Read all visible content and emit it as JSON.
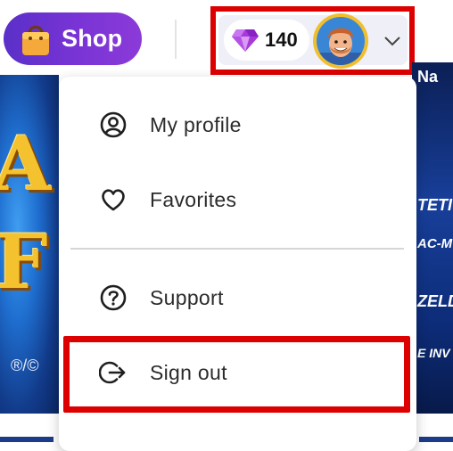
{
  "header": {
    "shop_label": "Shop",
    "gems_count": "140"
  },
  "menu": {
    "items": [
      {
        "label": "My profile",
        "icon": "user-circle-icon"
      },
      {
        "label": "Favorites",
        "icon": "heart-icon"
      },
      {
        "label": "Support",
        "icon": "question-circle-icon"
      },
      {
        "label": "Sign out",
        "icon": "sign-out-icon"
      }
    ]
  },
  "background": {
    "left_art_lines": [
      "A",
      "F"
    ],
    "left_mark": "®/©",
    "right_thumbs": [
      "Na",
      "TETI",
      "AC-M",
      "ZELD",
      "E INV"
    ]
  },
  "colors": {
    "shop_gradient_start": "#5a2fc8",
    "shop_gradient_end": "#8b3ad8",
    "highlight": "#dd0000",
    "avatar_ring": "#f0bf2e",
    "account_bg": "#efeff7"
  }
}
